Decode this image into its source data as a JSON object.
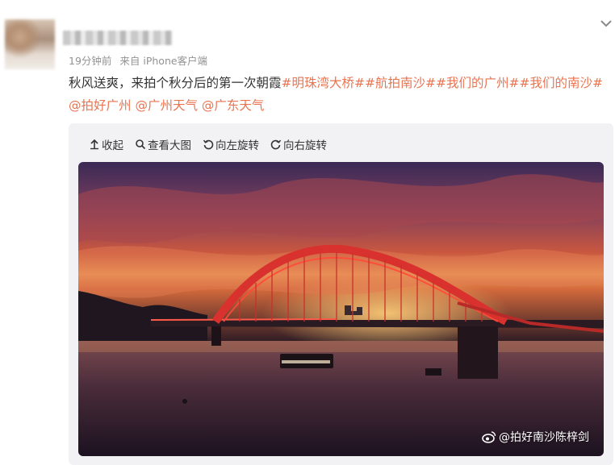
{
  "post": {
    "time": "19分钟前",
    "source": "来自 iPhone客户端",
    "text_plain": "秋风送爽，来拍个秋分后的第一次朝霞",
    "tags": [
      "#明珠湾大桥#",
      "#航拍南沙#",
      "#我们的广州#",
      "#我们的南沙#"
    ],
    "mentions": [
      "@拍好广州",
      "@广州天气",
      "@广东天气"
    ]
  },
  "toolbar": {
    "collapse": "收起",
    "view_large": "查看大图",
    "rotate_left": "向左旋转",
    "rotate_right": "向右旋转"
  },
  "image": {
    "watermark": "@拍好南沙陈梓剑"
  },
  "colors": {
    "accent": "#eb7350",
    "meta_text": "#939393",
    "card_bg": "#f2f2f5"
  }
}
